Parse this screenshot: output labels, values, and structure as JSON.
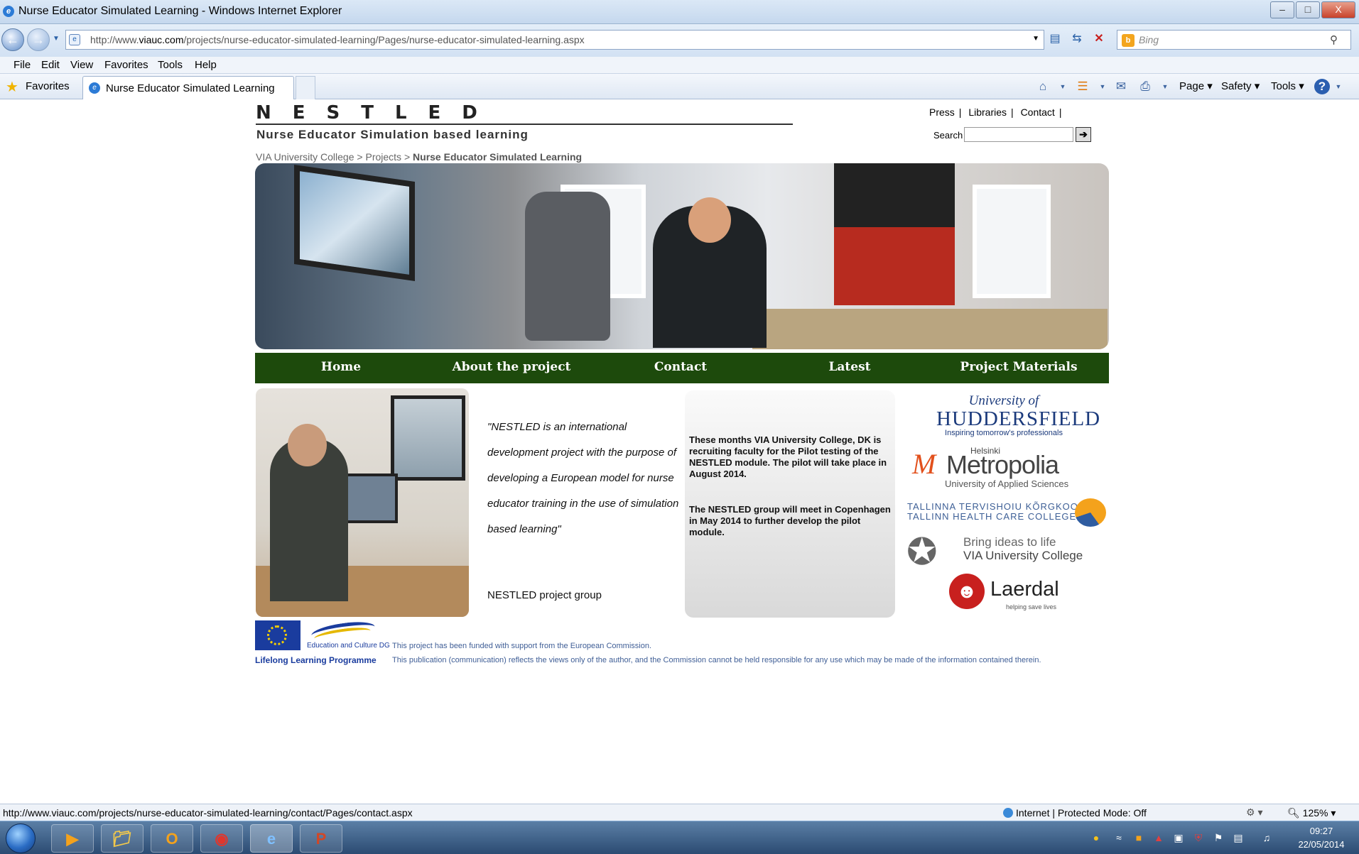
{
  "window": {
    "title": "Nurse Educator Simulated Learning - Windows Internet Explorer",
    "buttons": {
      "minimize": "–",
      "maximize": "□",
      "close": "X"
    }
  },
  "addressbar": {
    "url_prefix": "http://www.",
    "url_domain": "viauc.com",
    "url_path": "/projects/nurse-educator-simulated-learning/Pages/nurse-educator-simulated-learning.aspx",
    "search_placeholder": "Bing"
  },
  "menubar": [
    "File",
    "Edit",
    "View",
    "Favorites",
    "Tools",
    "Help"
  ],
  "favbar": {
    "favorites_label": "Favorites",
    "active_tab": "Nurse Educator Simulated Learning",
    "commands": [
      "Page",
      "Safety",
      "Tools"
    ]
  },
  "site": {
    "logo": "NESTLED",
    "tagline": "Nurse Educator Simulation based learning",
    "toplinks": [
      "Press",
      "Libraries",
      "Contact"
    ],
    "search_label": "Search",
    "breadcrumb": [
      "VIA University College",
      "Projects",
      "Nurse Educator Simulated Learning"
    ],
    "breadcrumb_sep": ">",
    "nav": [
      "Home",
      "About the project",
      "Contact",
      "Latest",
      "Project Materials"
    ],
    "quote": "\"NESTLED is an international development project with the purpose of developing a European model for nurse educator training in the use of simulation based learning\"",
    "quote_author": "NESTLED project group",
    "news1": "These months VIA University College, DK is recruiting faculty for the Pilot testing of the NESTLED module. The pilot will take place in August 2014.",
    "news2": "The NESTLED group will meet in Copenhagen in May 2014 to further develop the pilot module.",
    "partners": {
      "huddersfield": {
        "line1": "University of",
        "line2": "HUDDERSFIELD",
        "line3": "Inspiring tomorrow's professionals"
      },
      "metropolia": {
        "top": "Helsinki",
        "name": "Metropolia",
        "sub": "University of Applied Sciences"
      },
      "tallinn": {
        "line1": "TALLINNA TERVISHOIU KÕRGKOOL",
        "line2": "TALLINN HEALTH CARE COLLEGE"
      },
      "via": {
        "line1": "Bring ideas to life",
        "line2": "VIA University College"
      },
      "laerdal": {
        "name": "Laerdal",
        "sub": "helping save lives"
      }
    },
    "footer": {
      "edu_label": "Education and Culture DG",
      "llp": "Lifelong Learning Programme",
      "disclaimer1": "This project has been funded with support from the European Commission.",
      "disclaimer2": "This publication (communication) reflects the views only of the author, and the Commission cannot be held responsible for any use which may be made of the information contained therein."
    }
  },
  "statusbar": {
    "url": "http://www.viauc.com/projects/nurse-educator-simulated-learning/contact/Pages/contact.aspx",
    "zone": "Internet | Protected Mode: Off",
    "zoom": "125%"
  },
  "taskbar": {
    "time": "09:27",
    "date": "22/05/2014"
  },
  "colors": {
    "nav_bg": "#1d4a0c",
    "ie_blue": "#2c7bd6"
  }
}
